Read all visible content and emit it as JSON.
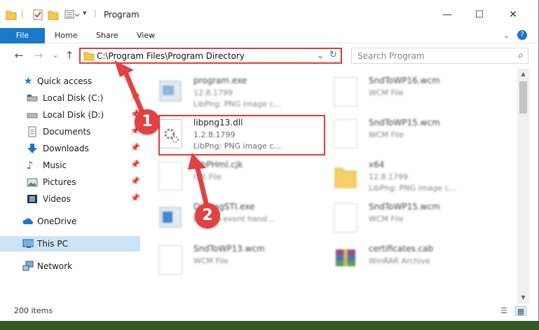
{
  "window": {
    "title": "Program"
  },
  "titlebar": {
    "minimize": "—",
    "maximize": "☐",
    "close": "✕"
  },
  "ribbon": {
    "file": "File",
    "tabs": [
      "Home",
      "Share",
      "View"
    ],
    "expand": "⌄",
    "help": "?"
  },
  "nav": {
    "back": "←",
    "forward": "→",
    "dropdown": "⌄",
    "up": "↑"
  },
  "address": {
    "path": "C:\\Program Files\\Program Directory",
    "dropdown": "⌄",
    "refresh": "↻"
  },
  "search": {
    "placeholder": "Search Program",
    "icon": "⌕"
  },
  "sidebar": {
    "items": [
      {
        "label": "Quick access",
        "icon": "star-icon",
        "pin": ""
      },
      {
        "label": "Local Disk (C:)",
        "icon": "drive-icon",
        "pin": "📌"
      },
      {
        "label": "Local Disk (D:)",
        "icon": "drive-icon",
        "pin": "📌"
      },
      {
        "label": "Documents",
        "icon": "documents-icon",
        "pin": "📌"
      },
      {
        "label": "Downloads",
        "icon": "downloads-icon",
        "pin": "📌"
      },
      {
        "label": "Music",
        "icon": "music-icon",
        "pin": "📌"
      },
      {
        "label": "Pictures",
        "icon": "pictures-icon",
        "pin": "📌"
      },
      {
        "label": "Videos",
        "icon": "videos-icon",
        "pin": "📌"
      },
      {
        "label": "OneDrive",
        "icon": "onedrive-icon",
        "pin": ""
      },
      {
        "label": "This PC",
        "icon": "this-pc-icon",
        "pin": ""
      },
      {
        "label": "Network",
        "icon": "network-icon",
        "pin": ""
      }
    ]
  },
  "files": [
    {
      "name": "program.exe",
      "line2": "12.8.1799",
      "line3": "LibPng: PNG image c...",
      "icon": "exe-icon"
    },
    {
      "name": "SndToWP16.wcm",
      "line2": "WCM File",
      "line3": "",
      "icon": "file-icon"
    },
    {
      "name": "libpng13.dll",
      "line2": "1.2.8.1799",
      "line3": "LibPng: PNG image c...",
      "icon": "dll-gear-icon"
    },
    {
      "name": "SndToWP15.wcm",
      "line2": "WCM File",
      "line3": "",
      "icon": "file-icon"
    },
    {
      "name": "lobPHml.cjk",
      "line2": "CJK File",
      "line3": "",
      "icon": "file-icon"
    },
    {
      "name": "x64",
      "line2": "12.8.1799",
      "line3": "LibPng: PNG image c...",
      "icon": "folder-icon"
    },
    {
      "name": "DxDiagSTI.exe",
      "line2": "Dxdiab event hand...",
      "line3": "",
      "icon": "exe-icon"
    },
    {
      "name": "SndToWP15.wcm",
      "line2": "WCM File",
      "line3": "",
      "icon": "file-icon"
    },
    {
      "name": "SndToWP13.wcm",
      "line2": "WCM File",
      "line3": "",
      "icon": "file-icon"
    },
    {
      "name": "certificates.cab",
      "line2": "WinRAR Archive",
      "line3": "",
      "icon": "winrar-icon"
    }
  ],
  "status": {
    "count": "200 items"
  },
  "annotations": {
    "step1": "1",
    "step2": "2"
  },
  "colors": {
    "accent": "#1979ca",
    "highlight": "#e03a3a",
    "selection": "#cce4f7"
  }
}
